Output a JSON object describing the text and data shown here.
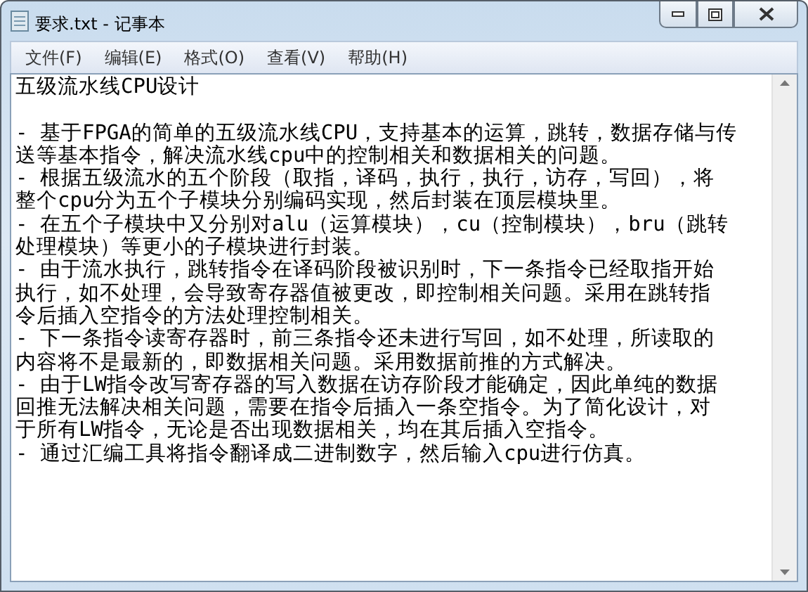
{
  "window": {
    "title": "要求.txt - 记事本"
  },
  "menu": [
    "文件(F)",
    "编辑(E)",
    "格式(O)",
    "查看(V)",
    "帮助(H)"
  ],
  "document": {
    "heading": "五级流水线CPU设计",
    "lines": [
      "- 基于FPGA的简单的五级流水线CPU，支持基本的运算，跳转，数据存储与传",
      "送等基本指令，解决流水线cpu中的控制相关和数据相关的问题。",
      "- 根据五级流水的五个阶段（取指，译码，执行，执行，访存，写回），将",
      "整个cpu分为五个子模块分别编码实现，然后封装在顶层模块里。",
      "- 在五个子模块中又分别对alu（运算模块），cu（控制模块），bru（跳转",
      "处理模块）等更小的子模块进行封装。",
      "- 由于流水执行，跳转指令在译码阶段被识别时，下一条指令已经取指开始",
      "执行，如不处理，会导致寄存器值被更改，即控制相关问题。采用在跳转指",
      "令后插入空指令的方法处理控制相关。",
      "- 下一条指令读寄存器时，前三条指令还未进行写回，如不处理，所读取的",
      "内容将不是最新的，即数据相关问题。采用数据前推的方式解决。",
      "- 由于LW指令改写寄存器的写入数据在访存阶段才能确定，因此单纯的数据",
      "回推无法解决相关问题，需要在指令后插入一条空指令。为了简化设计，对",
      "于所有LW指令，无论是否出现数据相关，均在其后插入空指令。",
      "- 通过汇编工具将指令翻译成二进制数字，然后输入cpu进行仿真。"
    ]
  }
}
